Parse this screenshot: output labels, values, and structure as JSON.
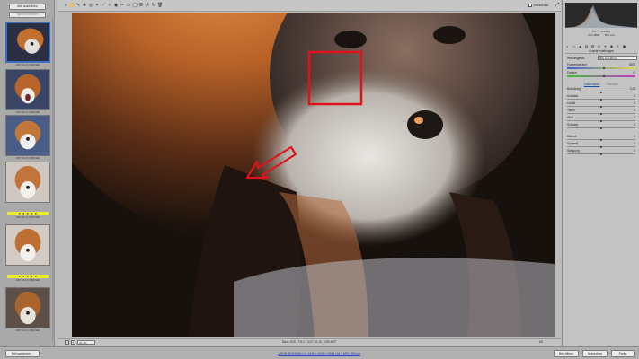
{
  "filmstrip": {
    "buttons": [
      "Alle auswählen",
      "Synchronisieren"
    ],
    "thumbs": [
      {
        "caption": "2017-01-16_0093.NEF",
        "rating": ""
      },
      {
        "caption": "2017-01-16_0096.NEF",
        "rating": ""
      },
      {
        "caption": "2017-01-16_0095.NEF",
        "rating": ""
      },
      {
        "caption": "2017-01-16_0097.NEF",
        "rating": "★ ★ ★ ★ ★"
      },
      {
        "caption": "2017-01-16_0098.NEF",
        "rating": "★ ★ ★ ★ ★"
      },
      {
        "caption": "2017-01-16_0099.NEF",
        "rating": ""
      }
    ]
  },
  "toolbar": {
    "tools": [
      "zoom-icon",
      "hand-icon",
      "white-balance-icon",
      "color-sampler-icon",
      "target-adjust-icon",
      "crop-icon",
      "straighten-icon",
      "spot-removal-icon",
      "red-eye-icon",
      "adjustment-brush-icon",
      "graduated-filter-icon",
      "radial-filter-icon",
      "preferences-icon",
      "rotate-left-icon",
      "rotate-right-icon",
      "trash-icon"
    ],
    "tool_glyphs": [
      "⌕",
      "✋",
      "✎",
      "✚",
      "◎",
      "⌗",
      "⟋",
      "✧",
      "◉",
      "✏",
      "▭",
      "◯",
      "☰",
      "↺",
      "↻",
      "🗑"
    ],
    "preview_label": "Vorschau"
  },
  "canvas": {
    "zoom_value": "21,4%",
    "filename": "Nikon D3S · F/4.0 · 2017-01-16_0093.NEF",
    "nav_count": "1/6"
  },
  "histogram": {
    "meta_left": [
      "f/4",
      "ISO 1600"
    ],
    "meta_right": [
      "1/640 s",
      "500 mm"
    ],
    "meta_rgb": [
      "R: ---",
      "G: ---",
      "B: ---"
    ]
  },
  "panel": {
    "title": "Grundeinstellungen",
    "white_balance_label": "Weißabgleich:",
    "white_balance_value": "Wie Aufnahme",
    "auto_label": "Automatisch",
    "standard_label": "Standard",
    "sliders": [
      {
        "label": "Farbtemperatur",
        "value": "5200",
        "pos": 0.55,
        "kind": "temp"
      },
      {
        "label": "Farbton",
        "value": "+7",
        "pos": 0.55,
        "kind": "tint"
      },
      {
        "label": "Belichtung",
        "value": "0,00",
        "pos": 0.5,
        "kind": ""
      },
      {
        "label": "Kontrast",
        "value": "0",
        "pos": 0.5,
        "kind": ""
      },
      {
        "label": "Lichter",
        "value": "0",
        "pos": 0.5,
        "kind": ""
      },
      {
        "label": "Tiefen",
        "value": "0",
        "pos": 0.5,
        "kind": ""
      },
      {
        "label": "Weiß",
        "value": "0",
        "pos": 0.5,
        "kind": ""
      },
      {
        "label": "Schwarz",
        "value": "0",
        "pos": 0.5,
        "kind": ""
      },
      {
        "label": "Klarheit",
        "value": "0",
        "pos": 0.5,
        "kind": ""
      },
      {
        "label": "Dynamik",
        "value": "0",
        "pos": 0.5,
        "kind": ""
      },
      {
        "label": "Sättigung",
        "value": "0",
        "pos": 0.5,
        "kind": ""
      }
    ]
  },
  "footer": {
    "save_label": "Bild speichern...",
    "workflow_link": "sRGB IEC61966-2.1; 16 Bit; 4928 × 3264 (16,1 MP); 300 ppi",
    "open_label": "Bild öffnen",
    "cancel_label": "Abbrechen",
    "done_label": "Fertig"
  },
  "colors": {
    "annotation_red": "#e0121a",
    "rating_yellow": "#ecec2a",
    "selection_blue": "#3a6fc1"
  }
}
